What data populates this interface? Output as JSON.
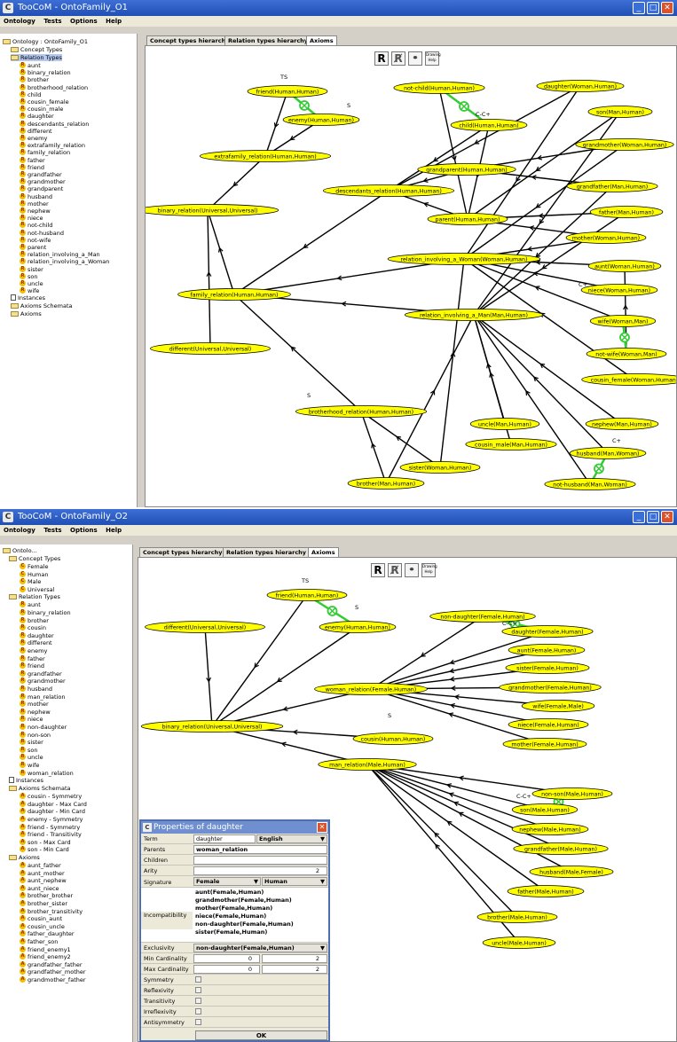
{
  "win1": {
    "title": "TooCoM - OntoFamily_O1",
    "menu": [
      "Ontology",
      "Tests",
      "Options",
      "Help"
    ],
    "tabs": [
      "Concept types hierarchy",
      "Relation types hierarchy",
      "Axioms"
    ],
    "help_label": "Drawing Help",
    "tree": {
      "root": "Ontology : OntoFamily_O1",
      "concept_types": "Concept Types",
      "relation_types": "Relation Types",
      "relations": [
        "aunt",
        "binary_relation",
        "brother",
        "brotherhood_relation",
        "child",
        "cousin_female",
        "cousin_male",
        "daughter",
        "descendants_relation",
        "different",
        "enemy",
        "extrafamily_relation",
        "family_relation",
        "father",
        "friend",
        "grandfather",
        "grandmother",
        "grandparent",
        "husband",
        "mother",
        "nephew",
        "niece",
        "not-child",
        "not-husband",
        "not-wife",
        "parent",
        "relation_involving_a_Man",
        "relation_involving_a_Woman",
        "sister",
        "son",
        "uncle",
        "wife"
      ],
      "instances": "Instances",
      "axioms_schemata": "Axioms Schemata",
      "axioms": "Axioms"
    },
    "nodes": [
      "friend(Human,Human)",
      "enemy(Human,Human)",
      "not-child(Human,Human)",
      "child(Human,Human)",
      "daughter(Woman,Human)",
      "son(Man,Human)",
      "grandmother(Woman,Human)",
      "extrafamily_relation(Human,Human)",
      "grandparent(Human,Human)",
      "descendants_relation(Human,Human)",
      "grandfather(Man,Human)",
      "binary_relation(Universal,Universal)",
      "father(Man,Human)",
      "parent(Human,Human)",
      "mother(Woman,Human)",
      "relation_involving_a_Woman(Woman,Human)",
      "aunt(Woman,Human)",
      "family_relation(Human,Human)",
      "niece(Woman,Human)",
      "relation_involving_a_Man(Man,Human)",
      "wife(Woman,Man)",
      "different(Universal,Universal)",
      "not-wife(Woman,Man)",
      "cousin_female(Woman,Human)",
      "brotherhood_relation(Human,Human)",
      "uncle(Man,Human)",
      "nephew(Man,Human)",
      "cousin_male(Man,Human)",
      "husband(Man,Woman)",
      "sister(Woman,Human)",
      "brother(Man,Human)",
      "not-husband(Man,Woman)"
    ],
    "edge_labels": [
      "TS",
      "S",
      "C-C+",
      "C+",
      "S",
      "C+"
    ]
  },
  "win2": {
    "title": "TooCoM - OntoFamily_O2",
    "menu": [
      "Ontology",
      "Tests",
      "Options",
      "Help"
    ],
    "tabs": [
      "Concept types hierarchy",
      "Relation types hierarchy",
      "Axioms"
    ],
    "help_label": "Drawing Help",
    "tree": {
      "root": "Ontolo...",
      "concept_types": "Concept Types",
      "concepts": [
        "Female",
        "Human",
        "Male",
        "Universal"
      ],
      "relation_types": "Relation Types",
      "relations": [
        "aunt",
        "binary_relation",
        "brother",
        "cousin",
        "daughter",
        "different",
        "enemy",
        "father",
        "friend",
        "grandfather",
        "grandmother",
        "husband",
        "man_relation",
        "mother",
        "nephew",
        "niece",
        "non-daughter",
        "non-son",
        "sister",
        "son",
        "uncle",
        "wife",
        "woman_relation"
      ],
      "instances": "Instances",
      "axioms_schemata": "Axioms Schemata",
      "schemata": [
        "cousin - Symmetry",
        "daughter - Max Card",
        "daughter - Min Card",
        "enemy - Symmetry",
        "friend - Symmetry",
        "friend - Transitivity",
        "son - Max Card",
        "son - Min Card"
      ],
      "axioms": "Axioms",
      "axiom_items": [
        "aunt_father",
        "aunt_mother",
        "aunt_nephew",
        "aunt_niece",
        "brother_brother",
        "brother_sister",
        "brother_transitivity",
        "cousin_aunt",
        "cousin_uncle",
        "father_daughter",
        "father_son",
        "friend_enemy1",
        "friend_enemy2",
        "grandfather_father",
        "grandfather_mother",
        "grandmother_father"
      ]
    },
    "nodes": [
      "friend(Human,Human)",
      "different(Universal,Universal)",
      "enemy(Human,Human)",
      "non-daughter(Female,Human)",
      "daughter(Female,Human)",
      "aunt(Female,Human)",
      "sister(Female,Human)",
      "woman_relation(Female,Human)",
      "grandmother(Female,Human)",
      "wife(Female,Male)",
      "binary_relation(Universal,Universal)",
      "cousin(Human,Human)",
      "niece(Female,Human)",
      "man_relation(Male,Human)",
      "mother(Female,Human)",
      "non-son(Male,Human)",
      "son(Male,Human)",
      "nephew(Male,Human)",
      "grandfather(Male,Human)",
      "husband(Male,Female)",
      "father(Male,Human)",
      "brother(Male,Human)",
      "uncle(Male,Human)"
    ],
    "edge_labels": [
      "TS",
      "S",
      "C-C+",
      "S",
      "C-C+"
    ]
  },
  "dialog": {
    "title": "Properties of daughter",
    "term_label": "Term",
    "term_value": "daughter",
    "language": "English",
    "parents_label": "Parents",
    "parents_value": "woman_relation",
    "children_label": "Children",
    "arity_label": "Arity",
    "arity_value": "2",
    "signature_label": "Signature",
    "sig1": "Female",
    "sig2": "Human",
    "incompat_label": "Incompatibility",
    "incompat": [
      "aunt(Female,Human)",
      "grandmother(Female,Human)",
      "mother(Female,Human)",
      "niece(Female,Human)",
      "non-daughter(Female,Human)",
      "sister(Female,Human)"
    ],
    "exclusivity_label": "Exclusivity",
    "exclusivity_value": "non-daughter(Female,Human)",
    "min_card_label": "Min Cardinality",
    "min1": "0",
    "min2": "2",
    "max_card_label": "Max Cardinality",
    "max1": "0",
    "max2": "2",
    "props": [
      "Symmetry",
      "Reflexivity",
      "Transitivity",
      "Irreflexivity",
      "Antisymmetry"
    ],
    "ok_label": "OK"
  },
  "colors": {
    "node_fill": "#ffff00",
    "title_blue": "#2452c2",
    "axiom_green": "#33cc33"
  }
}
